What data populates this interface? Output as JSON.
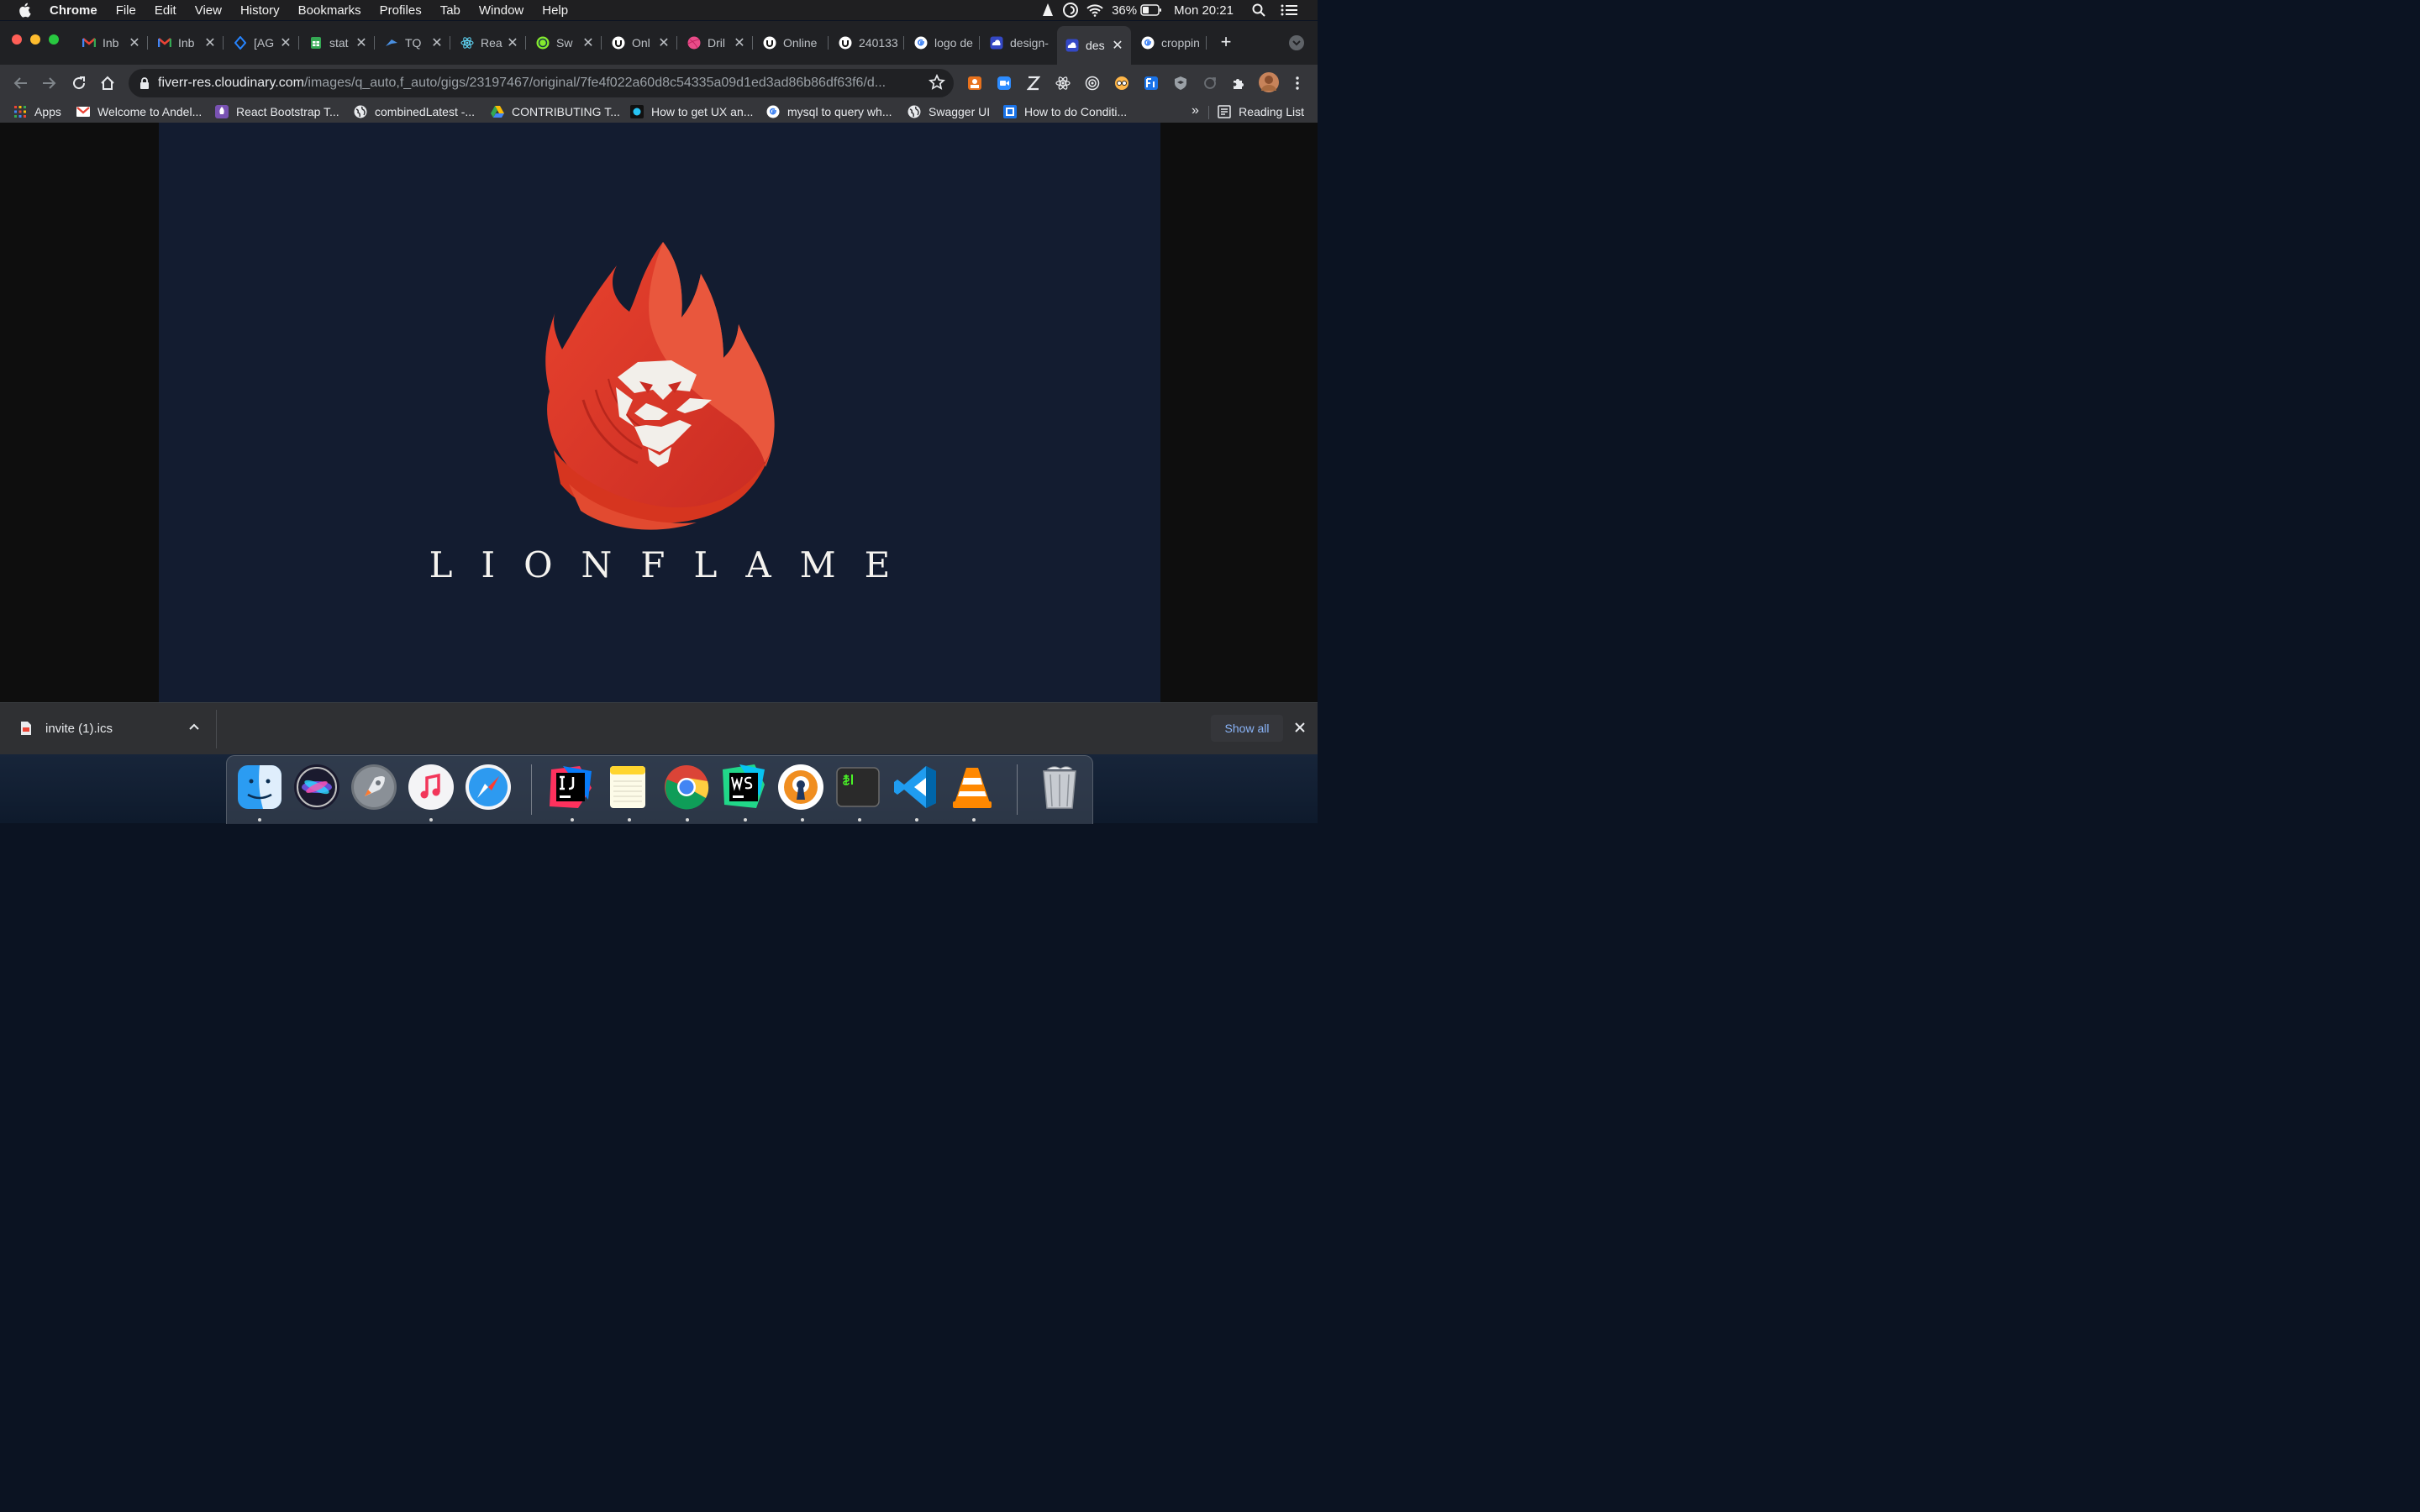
{
  "menubar": {
    "app_name": "Chrome",
    "items": [
      "File",
      "Edit",
      "View",
      "History",
      "Bookmarks",
      "Profiles",
      "Tab",
      "Window",
      "Help"
    ],
    "battery": "36%",
    "clock": "Mon 20:21"
  },
  "tabs": [
    {
      "label": "Inb",
      "icon": "gmail-icon"
    },
    {
      "label": "Inb",
      "icon": "gmail-icon"
    },
    {
      "label": "[AG",
      "icon": "jira-icon"
    },
    {
      "label": "stat",
      "icon": "sheets-icon"
    },
    {
      "label": "TQ",
      "icon": "bird-icon"
    },
    {
      "label": "Rea",
      "icon": "react-icon"
    },
    {
      "label": "Sw",
      "icon": "swagger-icon"
    },
    {
      "label": "Onl",
      "icon": "udemy-icon"
    },
    {
      "label": "Dril",
      "icon": "dribbble-icon"
    },
    {
      "label": "Online",
      "icon": "udemy-icon"
    },
    {
      "label": "240133",
      "icon": "udemy-icon"
    },
    {
      "label": "logo de",
      "icon": "google-icon"
    },
    {
      "label": "design-",
      "icon": "cloud-icon"
    },
    {
      "label": "des",
      "icon": "cloud-icon",
      "active": true
    },
    {
      "label": "croppin",
      "icon": "google-icon"
    }
  ],
  "address": {
    "domain": "fiverr-res.cloudinary.com",
    "path": "/images/q_auto,f_auto/gigs/23197467/original/7fe4f022a60d8c54335a09d1ed3ad86b86df63f6/d..."
  },
  "bookmarks": [
    {
      "label": "Apps",
      "icon": "apps-grid-icon"
    },
    {
      "label": "Welcome to Andel...",
      "icon": "gmail-icon"
    },
    {
      "label": "React Bootstrap T...",
      "icon": "rocket-icon"
    },
    {
      "label": "combinedLatest -...",
      "icon": "globe-icon"
    },
    {
      "label": "CONTRIBUTING T...",
      "icon": "drive-icon"
    },
    {
      "label": "How to get UX an...",
      "icon": "dot-icon"
    },
    {
      "label": "mysql to query wh...",
      "icon": "google-icon"
    },
    {
      "label": "Swagger UI",
      "icon": "globe-icon"
    },
    {
      "label": "How to do Conditi...",
      "icon": "blue-square-icon"
    }
  ],
  "bookmarks_more": "»",
  "reading_list": "Reading List",
  "image": {
    "wordmark": "LIONFLAME",
    "background": "#131c30",
    "flame_color": "#e0402c"
  },
  "download": {
    "filename": "invite (1).ics",
    "show_all": "Show all"
  },
  "dock": [
    "finder",
    "siri",
    "launchpad",
    "itunes",
    "safari",
    "intellij",
    "notes",
    "chrome",
    "webstorm",
    "openvpn",
    "terminal",
    "vscode",
    "vlc",
    "trash"
  ]
}
